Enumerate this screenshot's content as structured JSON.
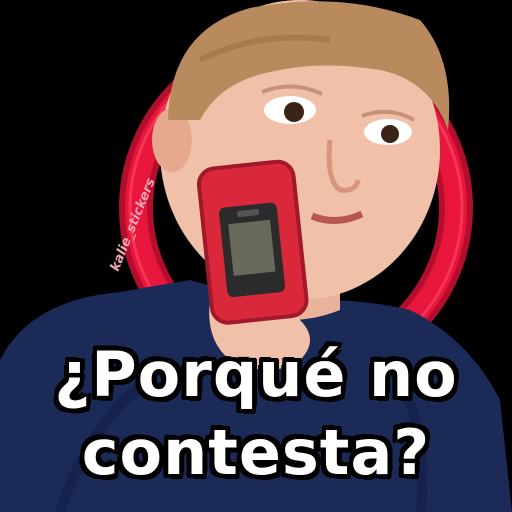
{
  "watermark": {
    "text": "kalie_stickers"
  },
  "caption": {
    "line1": "¿Porqué no",
    "line2": "contesta?"
  },
  "colors": {
    "background": "#000000",
    "ring": "#e8153c",
    "phone": "#d8283a",
    "caption_fill": "#ffffff",
    "caption_outline": "#000000"
  }
}
